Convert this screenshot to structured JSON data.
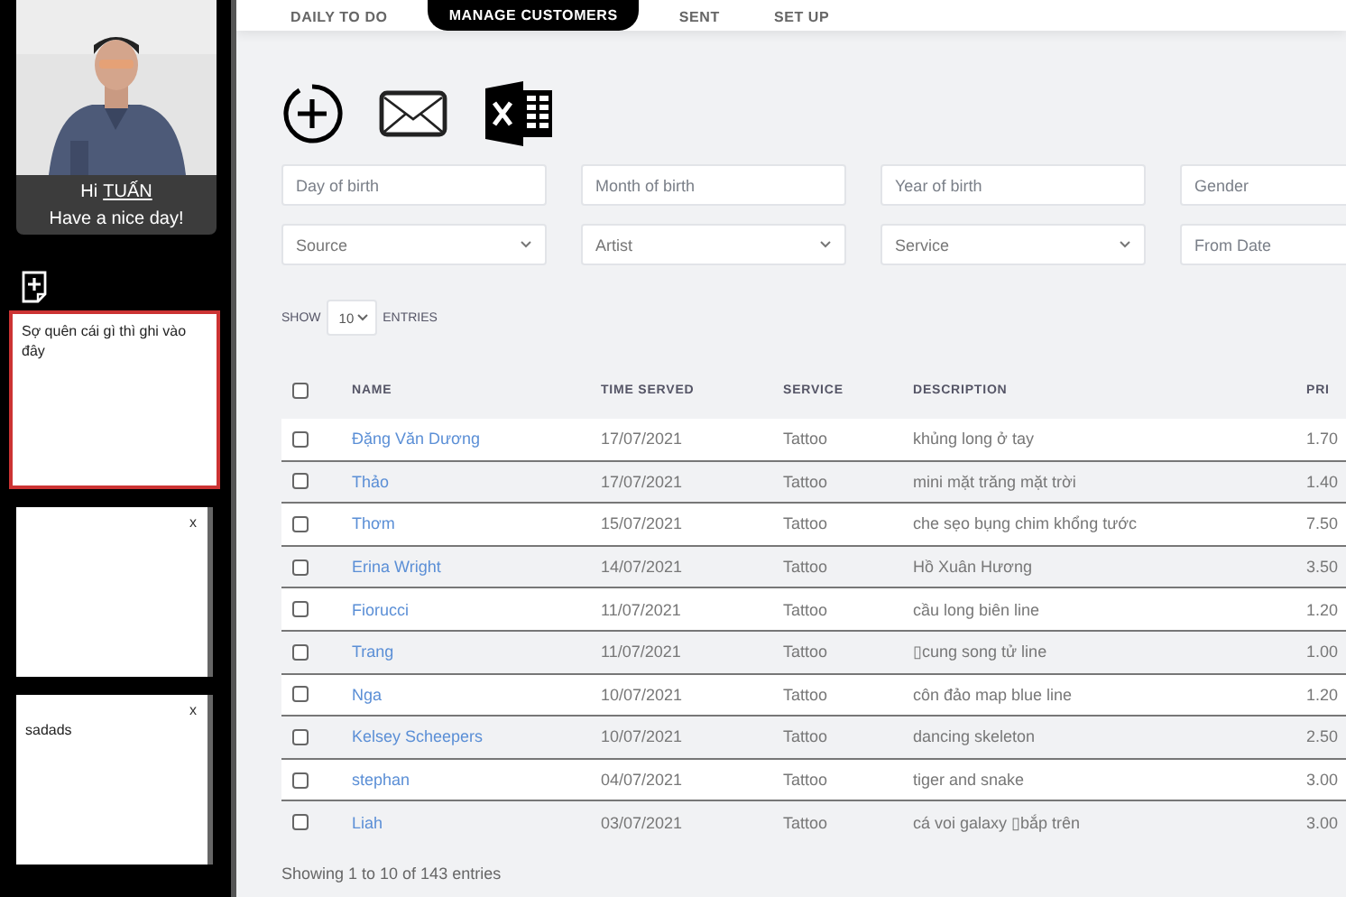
{
  "sidebar": {
    "profile": {
      "greeting": "Hi",
      "user": "TUẤN",
      "message": "Have a nice day!"
    },
    "notes": [
      {
        "text": "Sợ quên cái gì thì ghi vào đây",
        "selected": true
      },
      {
        "close": "x",
        "selected": false
      },
      {
        "close": "x",
        "text": "sadads",
        "selected": false
      }
    ]
  },
  "tabs": [
    {
      "label": "DAILY TO DO",
      "selected": false
    },
    {
      "label": "MANAGE CUSTOMERS",
      "selected": true
    },
    {
      "label": "SENT",
      "selected": false
    },
    {
      "label": "SET UP",
      "selected": false
    }
  ],
  "filters": [
    {
      "kind": "input",
      "placeholder": "Day of birth"
    },
    {
      "kind": "input",
      "placeholder": "Month of birth"
    },
    {
      "kind": "input",
      "placeholder": "Year of birth"
    },
    {
      "kind": "input",
      "placeholder": "Gender"
    },
    {
      "kind": "select",
      "placeholder": "Source"
    },
    {
      "kind": "select",
      "placeholder": "Artist"
    },
    {
      "kind": "select",
      "placeholder": "Service"
    },
    {
      "kind": "input",
      "placeholder": "From Date"
    }
  ],
  "entries": {
    "label": "SHOW",
    "value": "10",
    "suffix": "ENTRIES"
  },
  "table": {
    "header_checked": false,
    "columns": [
      "NAME",
      "TIME SERVED",
      "SERVICE",
      "DESCRIPTION",
      "PRI"
    ],
    "rows": [
      {
        "checked": false,
        "cells": [
          "Đặng Văn Dương",
          "17/07/2021",
          "Tattoo",
          "khủng long ở tay",
          "1.70"
        ]
      },
      {
        "checked": false,
        "cells": [
          "Thảo",
          "17/07/2021",
          "Tattoo",
          "mini mặt trăng mặt trời",
          "1.40"
        ]
      },
      {
        "checked": false,
        "cells": [
          "Thơm",
          "15/07/2021",
          "Tattoo",
          "che sẹo bụng chim khổng tước",
          "7.50"
        ]
      },
      {
        "checked": false,
        "cells": [
          "Erina Wright",
          "14/07/2021",
          "Tattoo",
          "Hồ Xuân Hương",
          "3.50"
        ]
      },
      {
        "checked": false,
        "cells": [
          "Fiorucci",
          "11/07/2021",
          "Tattoo",
          "cầu long biên line",
          "1.20"
        ]
      },
      {
        "checked": false,
        "cells": [
          "Trang",
          "11/07/2021",
          "Tattoo",
          "▯cung song tử line",
          "1.00"
        ]
      },
      {
        "checked": false,
        "cells": [
          "Nga",
          "10/07/2021",
          "Tattoo",
          "côn đảo map blue line",
          "1.20"
        ]
      },
      {
        "checked": false,
        "cells": [
          "Kelsey Scheepers",
          "10/07/2021",
          "Tattoo",
          "dancing skeleton",
          "2.50"
        ]
      },
      {
        "checked": false,
        "cells": [
          "stephan",
          "04/07/2021",
          "Tattoo",
          "tiger and snake",
          "3.00"
        ]
      },
      {
        "checked": false,
        "cells": [
          "Liah",
          "03/07/2021",
          "Tattoo",
          "cá voi galaxy ▯bắp trên",
          "3.00"
        ]
      }
    ]
  },
  "footer": "Showing 1 to 10 of 143 entries"
}
